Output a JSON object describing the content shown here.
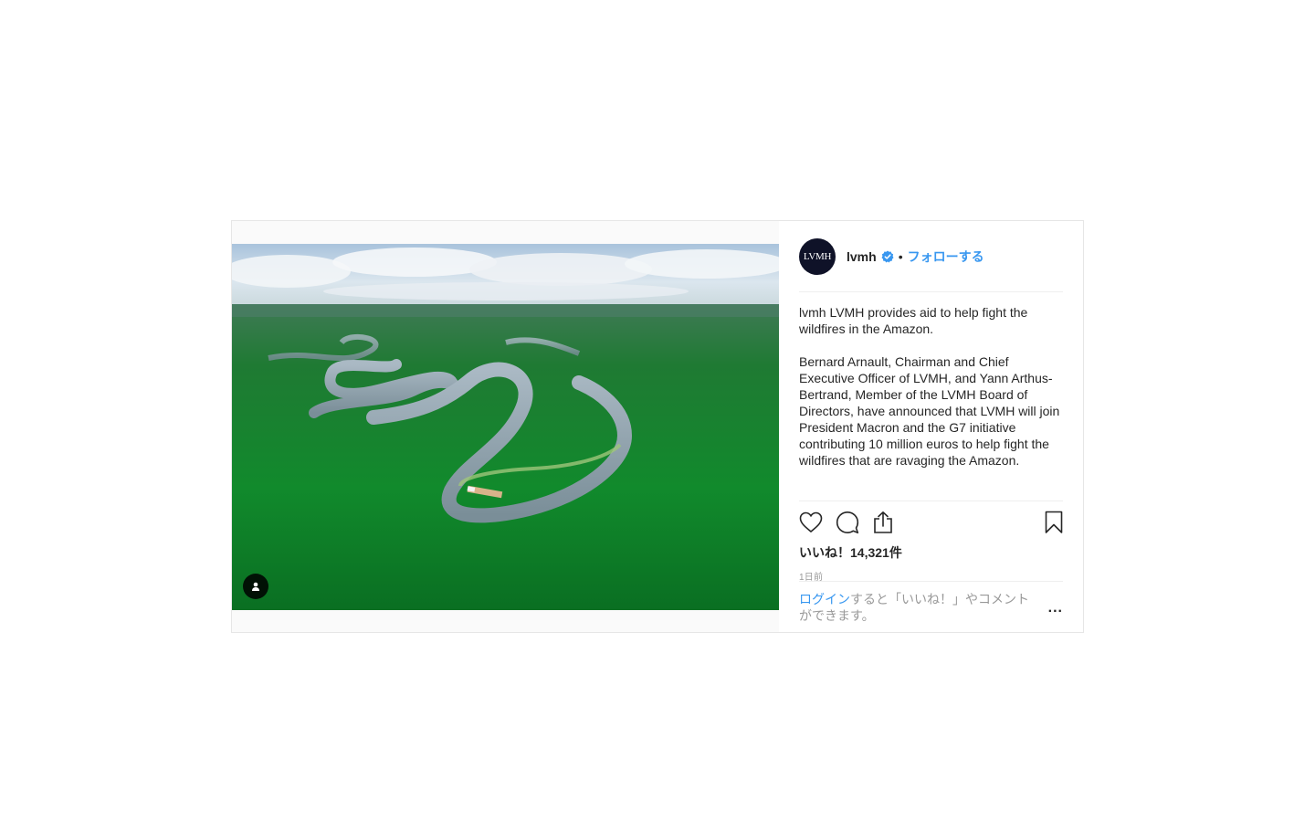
{
  "post": {
    "author": {
      "username": "lvmh",
      "avatar_text": "LVMH",
      "verified": true,
      "follow_label": "フォローする",
      "separator": "•"
    },
    "caption": {
      "username": "lvmh",
      "line1": "LVMH provides aid to help fight the wildfires in the Amazon.",
      "line2": "Bernard Arnault, Chairman and Chief Executive Officer of LVMH, and Yann Arthus-Bertrand, Member of the LVMH Board of Directors, have announced that LVMH will join President Macron and the G7 initiative contributing 10 million euros to help fight the wildfires that are ravaging the Amazon."
    },
    "likes_text": "いいね！14,321件",
    "timestamp": "1日前",
    "footer": {
      "login_link": "ログイン",
      "message_rest": "すると「いいね！」やコメントができます。",
      "more_label": "..."
    },
    "icons": {
      "like": "heart-icon",
      "comment": "comment-icon",
      "share": "share-icon",
      "save": "bookmark-icon",
      "tagged": "user-tag-icon",
      "verified": "verified-badge-icon"
    },
    "colors": {
      "accent": "#3897f0",
      "text": "#262626",
      "muted": "#999999",
      "border": "#efefef",
      "avatar_bg": "#0f1228"
    }
  }
}
